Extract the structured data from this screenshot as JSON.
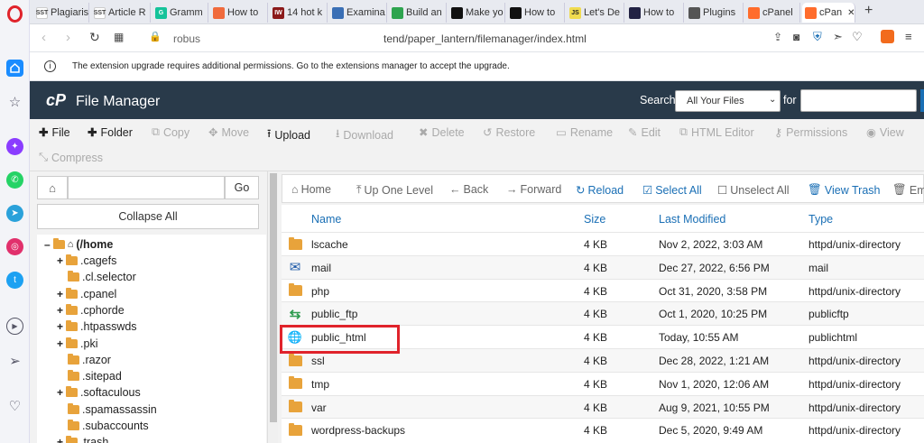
{
  "browser": {
    "tabs": [
      {
        "label": "Plagiaris",
        "fav": "SST",
        "color": "#ffffff",
        "text": "#444"
      },
      {
        "label": "Article R",
        "fav": "SST",
        "color": "#ffffff",
        "text": "#444"
      },
      {
        "label": "Gramm",
        "fav": "G",
        "color": "#15c39a",
        "text": "#fff"
      },
      {
        "label": "How to",
        "fav": "",
        "color": "#f06a3c",
        "text": "#fff"
      },
      {
        "label": "14 hot k",
        "fav": "IW",
        "color": "#8b1a1a",
        "text": "#fff"
      },
      {
        "label": "Examina",
        "fav": "",
        "color": "#3a6fb5",
        "text": "#fff"
      },
      {
        "label": "Build an",
        "fav": "",
        "color": "#2ea44f",
        "text": "#fff"
      },
      {
        "label": "Make yo",
        "fav": "",
        "color": "#111111",
        "text": "#fff"
      },
      {
        "label": "How to",
        "fav": "",
        "color": "#111111",
        "text": "#fff"
      },
      {
        "label": "Let's De",
        "fav": "JS",
        "color": "#f0db4f",
        "text": "#222"
      },
      {
        "label": "How to",
        "fav": "",
        "color": "#222244",
        "text": "#fff"
      },
      {
        "label": "Plugins",
        "fav": "",
        "color": "#555555",
        "text": "#fff"
      },
      {
        "label": "cPanel",
        "fav": "",
        "color": "#ff6c2c",
        "text": "#fff"
      },
      {
        "label": "cPan",
        "fav": "",
        "color": "#ff6c2c",
        "text": "#fff"
      }
    ],
    "new_tab": "+",
    "address_left": "robus",
    "address_right": "tend/paper_lantern/filemanager/index.html",
    "notice": "The extension upgrade requires additional permissions. Go to the extensions manager to accept the upgrade."
  },
  "header": {
    "logo": "cP",
    "title": "File Manager",
    "search_label": "Search",
    "search_scope": "All Your Files",
    "for_label": "for",
    "search_value": ""
  },
  "toolbar": {
    "file": "File",
    "folder": "Folder",
    "copy": "Copy",
    "move": "Move",
    "upload": "Upload",
    "download": "Download",
    "delete": "Delete",
    "restore": "Restore",
    "rename": "Rename",
    "edit": "Edit",
    "html_editor": "HTML Editor",
    "permissions": "Permissions",
    "view": "View",
    "compress": "Compress"
  },
  "leftpanel": {
    "path_value": "",
    "go": "Go",
    "collapse_all": "Collapse All",
    "root": "(/home",
    "tree": [
      {
        "name": ".cagefs",
        "expand": true
      },
      {
        "name": ".cl.selector",
        "expand": false
      },
      {
        "name": ".cpanel",
        "expand": true
      },
      {
        "name": ".cphorde",
        "expand": true
      },
      {
        "name": ".htpasswds",
        "expand": true
      },
      {
        "name": ".pki",
        "expand": true
      },
      {
        "name": ".razor",
        "expand": false
      },
      {
        "name": ".sitepad",
        "expand": false
      },
      {
        "name": ".softaculous",
        "expand": true
      },
      {
        "name": ".spamassassin",
        "expand": false
      },
      {
        "name": ".subaccounts",
        "expand": false
      },
      {
        "name": ".trash",
        "expand": true
      }
    ]
  },
  "navbar": {
    "home": "Home",
    "up_one_level": "Up One Level",
    "back": "Back",
    "forward": "Forward",
    "reload": "Reload",
    "select_all": "Select All",
    "unselect_all": "Unselect All",
    "view_trash": "View Trash",
    "empty": "Emp"
  },
  "table": {
    "columns": {
      "name": "Name",
      "size": "Size",
      "modified": "Last Modified",
      "type": "Type"
    },
    "rows": [
      {
        "name": "lscache",
        "size": "4 KB",
        "modified": "Nov 2, 2022, 3:03 AM",
        "type": "httpd/unix-directory",
        "icon": "folder-icon"
      },
      {
        "name": "mail",
        "size": "4 KB",
        "modified": "Dec 27, 2022, 6:56 PM",
        "type": "mail",
        "icon": "mail-icon"
      },
      {
        "name": "php",
        "size": "4 KB",
        "modified": "Oct 31, 2020, 3:58 PM",
        "type": "httpd/unix-directory",
        "icon": "folder-icon"
      },
      {
        "name": "public_ftp",
        "size": "4 KB",
        "modified": "Oct 1, 2020, 10:25 PM",
        "type": "publicftp",
        "icon": "transfer-icon"
      },
      {
        "name": "public_html",
        "size": "4 KB",
        "modified": "Today, 10:55 AM",
        "type": "publichtml",
        "icon": "globe-icon"
      },
      {
        "name": "ssl",
        "size": "4 KB",
        "modified": "Dec 28, 2022, 1:21 AM",
        "type": "httpd/unix-directory",
        "icon": "folder-icon"
      },
      {
        "name": "tmp",
        "size": "4 KB",
        "modified": "Nov 1, 2020, 12:06 AM",
        "type": "httpd/unix-directory",
        "icon": "folder-icon"
      },
      {
        "name": "var",
        "size": "4 KB",
        "modified": "Aug 9, 2021, 10:55 PM",
        "type": "httpd/unix-directory",
        "icon": "folder-icon"
      },
      {
        "name": "wordpress-backups",
        "size": "4 KB",
        "modified": "Dec 5, 2020, 9:49 AM",
        "type": "httpd/unix-directory",
        "icon": "folder-icon"
      }
    ]
  },
  "colors": {
    "accent": "#1a6fb5",
    "header_bg": "#293a4a",
    "highlight": "#e0232b"
  }
}
